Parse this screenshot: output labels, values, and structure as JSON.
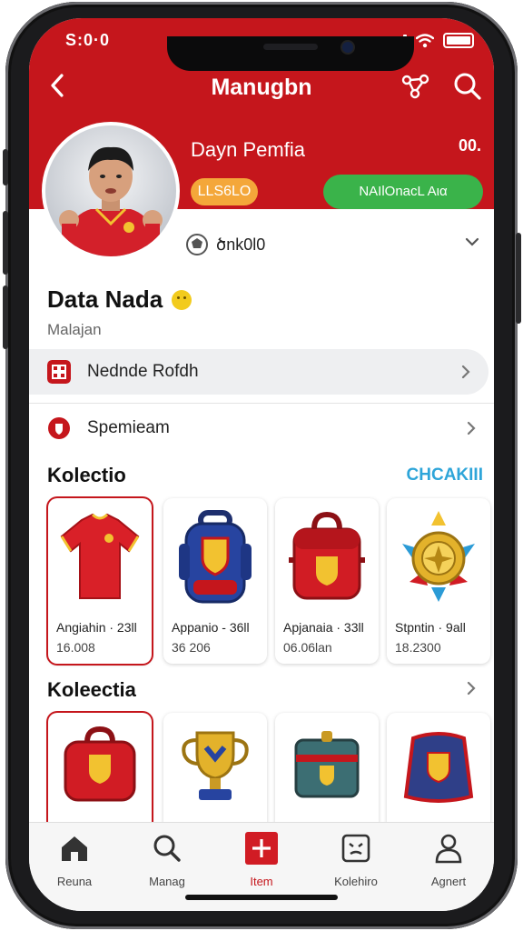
{
  "status": {
    "time": "S:0·0"
  },
  "header": {
    "title": "Manugbn"
  },
  "profile": {
    "name": "Dayn Pemfia",
    "count": "00.",
    "level": "LLS6LO",
    "action_button": "ΝΑΙlΟnacL Aια",
    "meta": "ծnk0l0",
    "display_name": "Data Nada",
    "location": "Malajan"
  },
  "menu": [
    {
      "label": "Nednde Rofdh"
    },
    {
      "label": "Spemieam"
    }
  ],
  "collection1": {
    "title": "Kolectio",
    "link": "CHCAKIII",
    "items": [
      {
        "name": "Angiahin · 23ll",
        "price": "16.008",
        "icon": "jersey-icon"
      },
      {
        "name": "Appanio - 36ll",
        "price": "36 206",
        "icon": "backpack-icon"
      },
      {
        "name": "Apjanaia · 33ll",
        "price": "06.06lan",
        "icon": "bag-icon"
      },
      {
        "name": "Stpntin · 9all",
        "price": "18.2300",
        "icon": "emblem-icon"
      }
    ]
  },
  "collection2": {
    "title": "Koleectia",
    "items": [
      {
        "icon": "bag-icon"
      },
      {
        "icon": "trophy-icon"
      },
      {
        "icon": "chest-icon"
      },
      {
        "icon": "pouch-icon"
      }
    ]
  },
  "tabs": [
    {
      "label": "Reuna",
      "icon": "home-icon"
    },
    {
      "label": "Manag",
      "icon": "search-icon"
    },
    {
      "label": "Item",
      "icon": "plus-icon"
    },
    {
      "label": "Kolehiro",
      "icon": "face-icon"
    },
    {
      "label": "Agnert",
      "icon": "person-icon"
    }
  ],
  "colors": {
    "brand": "#c5161c",
    "accent_green": "#3ab34a",
    "accent_orange": "#f4a73a",
    "link": "#2ea5d9"
  }
}
